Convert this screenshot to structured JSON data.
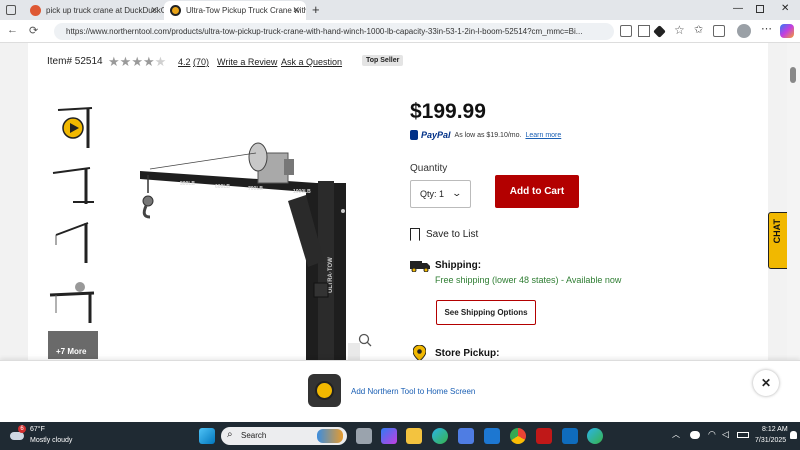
{
  "browser": {
    "tabs": [
      {
        "title": "pick up truck crane at DuckDuckG",
        "active": false
      },
      {
        "title": "Ultra-Tow Pickup Truck Crane with",
        "active": true
      }
    ],
    "url": "https://www.northerntool.com/products/ultra-tow-pickup-truck-crane-with-hand-winch-1000-lb-capacity-33in-53-1-2in-l-boom-52514?cm_mmc=Bi..."
  },
  "product": {
    "item_number": "Item# 52514",
    "rating": "4.2",
    "rating_value": 4.2,
    "review_count": "(70)",
    "write_review": "Write a Review",
    "ask_question": "Ask a Question",
    "badge": "Top Seller",
    "price": "$199.99",
    "paypal_brand": "PayPal",
    "paypal_text": "As low as $19.10/mo.",
    "paypal_learn": "Learn more",
    "quantity_label": "Quantity",
    "qty_value": "Qty: 1",
    "add_to_cart": "Add to Cart",
    "save_to_list": "Save to List",
    "shipping_title": "Shipping:",
    "shipping_detail": "Free shipping (lower 48 states) - Available now",
    "shipping_options": "See Shipping Options",
    "store_pickup": "Store Pickup:",
    "more_images": "+7 More",
    "boom_labels": [
      "500LB",
      "600LB",
      "700LB",
      "1000LB"
    ],
    "brand_on_post": "ULTRA·TOW"
  },
  "chat_label": "CHAT",
  "banner": {
    "text": "Add Northern Tool to Home Screen"
  },
  "taskbar": {
    "temp": "67°F",
    "weather": "Mostly cloudy",
    "weather_badge": "6",
    "search": "Search",
    "time": "8:12 AM",
    "date": "7/31/2025"
  },
  "colors": {
    "cart_red": "#b30000",
    "paypal_blue": "#003087",
    "shipping_green": "#2e7d32",
    "link_blue": "#1a5fb4"
  }
}
